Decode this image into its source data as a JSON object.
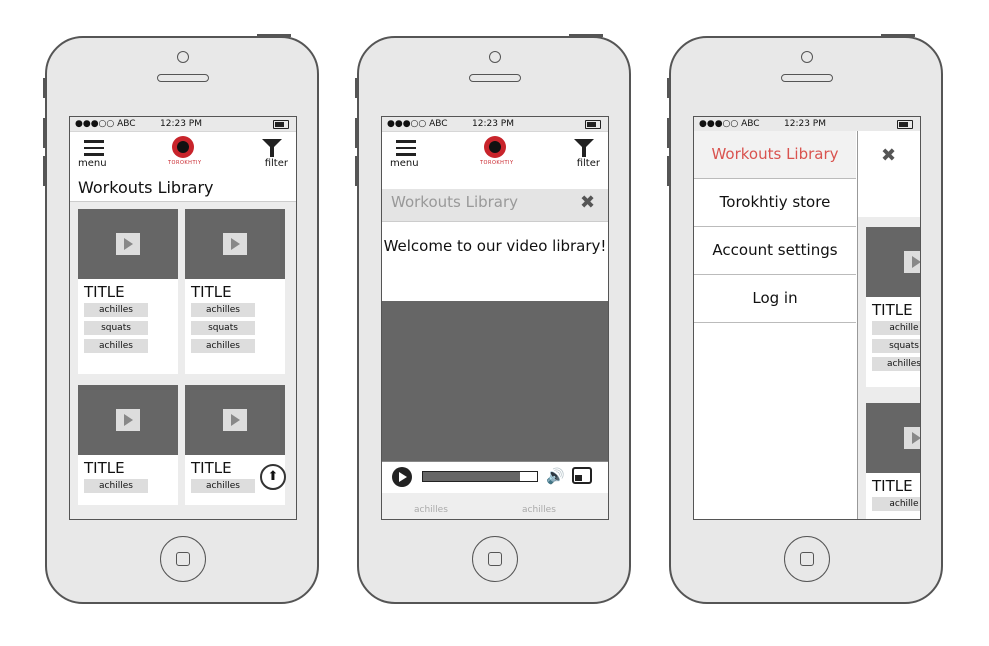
{
  "status": {
    "carrier": "●●●○○ ABC",
    "time": "12:23 PM"
  },
  "header": {
    "menu_label": "menu",
    "filter_label": "filter",
    "logo_text": "TOROKHTIY"
  },
  "library_title": "Workouts Library",
  "cards": [
    {
      "title": "TITLE",
      "tags": [
        "achilles",
        "squats",
        "achilles"
      ]
    },
    {
      "title": "TITLE",
      "tags": [
        "achilles",
        "squats",
        "achilles"
      ]
    },
    {
      "title": "TITLE",
      "tags": [
        "achilles"
      ]
    },
    {
      "title": "TITLE",
      "tags": [
        "achilles"
      ]
    }
  ],
  "video_screen": {
    "title": "Workouts Library",
    "welcome_text": "Welcome to our video library!",
    "progress": 0.85,
    "dim_tags": [
      "achilles",
      "achilles"
    ]
  },
  "drawer": {
    "items": [
      "Workouts Library",
      "Torokhtiy store",
      "Account settings",
      "Log in"
    ],
    "active_index": 0,
    "peek_cards": [
      {
        "title": "TITLE",
        "tags": [
          "achille",
          "squats",
          "achilles"
        ]
      },
      {
        "title": "TITLE",
        "tags": [
          "achille"
        ]
      }
    ]
  },
  "colors": {
    "accent": "#d9534f",
    "logo": "#c8242b",
    "thumb": "#666666"
  }
}
